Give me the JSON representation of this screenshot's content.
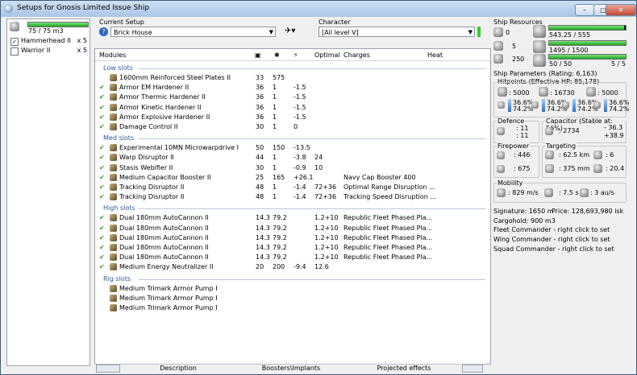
{
  "window": {
    "title": "Setups for Gnosis Limited Issue Ship"
  },
  "cargo": {
    "value": "75 / 75 m3",
    "fill": 1.0
  },
  "drones": [
    {
      "label": "Hammerhead II",
      "count": "x 5",
      "checked": true
    },
    {
      "label": "Warrior II",
      "count": "x 5",
      "checked": false
    }
  ],
  "setup": {
    "heading": "Current Setup",
    "value": "Brick House"
  },
  "character": {
    "heading": "Character",
    "value": "[All level V]"
  },
  "columns": {
    "modules": "Modules",
    "optimal": "Optimal",
    "charges": "Charges",
    "heat": "Heat"
  },
  "slots": [
    {
      "title": "Low slots",
      "items": [
        {
          "name": "1600mm Reinforced Steel Plates II",
          "a": "33",
          "b": "575",
          "c": "",
          "optimal": "",
          "charges": "",
          "check": false
        },
        {
          "name": "Armor EM Hardener II",
          "a": "36",
          "b": "1",
          "c": "-1.5",
          "optimal": "",
          "charges": "",
          "check": true
        },
        {
          "name": "Armor Thermic Hardener II",
          "a": "36",
          "b": "1",
          "c": "-1.5",
          "optimal": "",
          "charges": "",
          "check": true
        },
        {
          "name": "Armor Kinetic Hardener II",
          "a": "36",
          "b": "1",
          "c": "-1.5",
          "optimal": "",
          "charges": "",
          "check": true
        },
        {
          "name": "Armor Explosive Hardener II",
          "a": "36",
          "b": "1",
          "c": "-1.5",
          "optimal": "",
          "charges": "",
          "check": true
        },
        {
          "name": "Damage Control II",
          "a": "30",
          "b": "1",
          "c": "0",
          "optimal": "",
          "charges": "",
          "check": true
        }
      ]
    },
    {
      "title": "Med slots",
      "items": [
        {
          "name": "Experimental 10MN Microwarpdrive I",
          "a": "50",
          "b": "150",
          "c": "-13.5",
          "optimal": "",
          "charges": "",
          "check": true
        },
        {
          "name": "Warp Disruptor II",
          "a": "44",
          "b": "1",
          "c": "-3.8",
          "optimal": "24",
          "charges": "",
          "check": true
        },
        {
          "name": "Stasis Webifier II",
          "a": "30",
          "b": "1",
          "c": "-0.9",
          "optimal": "10",
          "charges": "",
          "check": true
        },
        {
          "name": "Medium Capacitor Booster II",
          "a": "25",
          "b": "165",
          "c": "+26.1",
          "optimal": "",
          "charges": "Navy Cap Booster 400",
          "check": true
        },
        {
          "name": "Tracking Disruptor II",
          "a": "48",
          "b": "1",
          "c": "-1.4",
          "optimal": "72+36",
          "charges": "Optimal Range Disruption ...",
          "check": true
        },
        {
          "name": "Tracking Disruptor II",
          "a": "48",
          "b": "1",
          "c": "-1.4",
          "optimal": "72+36",
          "charges": "Tracking Speed Disruption ...",
          "check": true
        }
      ]
    },
    {
      "title": "High slots",
      "items": [
        {
          "name": "Dual 180mm AutoCannon II",
          "a": "14.3",
          "b": "79.2",
          "c": "",
          "optimal": "1.2+10",
          "charges": "Republic Fleet Phased Pla...",
          "check": true
        },
        {
          "name": "Dual 180mm AutoCannon II",
          "a": "14.3",
          "b": "79.2",
          "c": "",
          "optimal": "1.2+10",
          "charges": "Republic Fleet Phased Pla...",
          "check": true
        },
        {
          "name": "Dual 180mm AutoCannon II",
          "a": "14.3",
          "b": "79.2",
          "c": "",
          "optimal": "1.2+10",
          "charges": "Republic Fleet Phased Pla...",
          "check": true
        },
        {
          "name": "Dual 180mm AutoCannon II",
          "a": "14.3",
          "b": "79.2",
          "c": "",
          "optimal": "1.2+10",
          "charges": "Republic Fleet Phased Pla...",
          "check": true
        },
        {
          "name": "Dual 180mm AutoCannon II",
          "a": "14.3",
          "b": "79.2",
          "c": "",
          "optimal": "1.2+10",
          "charges": "Republic Fleet Phased Pla...",
          "check": true
        },
        {
          "name": "Medium Energy Neutralizer II",
          "a": "20",
          "b": "200",
          "c": "-9.4",
          "optimal": "12.6",
          "charges": "",
          "check": true
        }
      ]
    },
    {
      "title": "Rig slots",
      "items": [
        {
          "name": "Medium Trimark Armor Pump I",
          "a": "",
          "b": "",
          "c": "",
          "optimal": "",
          "charges": "",
          "check": false
        },
        {
          "name": "Medium Trimark Armor Pump I",
          "a": "",
          "b": "",
          "c": "",
          "optimal": "",
          "charges": "",
          "check": false
        },
        {
          "name": "Medium Trimark Armor Pump I",
          "a": "",
          "b": "",
          "c": "",
          "optimal": "",
          "charges": "",
          "check": false
        }
      ]
    }
  ],
  "resources": {
    "title": "Ship Resources",
    "hardpoints": {
      "turret": "0",
      "launcher": "5",
      "calibration": "250"
    },
    "cpu": {
      "value": "543.25 / 555",
      "fill": 0.979
    },
    "power": {
      "value": "1495 / 1500",
      "fill": 0.997
    },
    "drone_bay": {
      "value": "50 / 50",
      "extra": "5 / 5",
      "fill": 1.0
    }
  },
  "params": {
    "title": "Ship Parameters (Rating: 6,163)",
    "hitpoints_title": "Hitpoints (Effective HP: 85,178)",
    "hp": {
      "shield": "5000",
      "armor": "16730",
      "hull": "5000"
    },
    "resists": [
      {
        "top": "36.6%",
        "bottom": "74.2%"
      },
      {
        "top": "36.6%",
        "bottom": "74.2%"
      },
      {
        "top": "36.6%",
        "bottom": "74.2%"
      },
      {
        "top": "36.6%",
        "bottom": "74.2%"
      }
    ],
    "defence": {
      "title": "Defence",
      "v1": ": 11",
      "v2": ": 11"
    },
    "capacitor": {
      "title": "Capacitor (Stable at: 56%)",
      "value": ": 2734",
      "delta_top": "- 36.3",
      "delta_bottom": "+38.9"
    },
    "firepower": {
      "title": "Firepower",
      "v1": ": 446",
      "v2": ": 675"
    },
    "targeting": {
      "title": "Targeting",
      "range": ": 62.5 km",
      "targets": ": 6",
      "resolution": ": 375 mm",
      "sensor": ": 20.4"
    },
    "mobility": {
      "title": "Mobility",
      "speed": ": 829 m/s",
      "align": ": 7.5 s",
      "warp": ": 3 au/s"
    },
    "signature": "Signature: 1650 m",
    "price": "Price: 128,693,980 isk",
    "cargohold": "Cargohold: 900 m3",
    "fleet": "Fleet Commander - right click to set",
    "wing": "Wing Commander - right click to set",
    "squad": "Squad Commander - right click to set"
  },
  "tabs": {
    "description": "Description",
    "boosters": "Boosters\\Implants",
    "projected": "Projected effects"
  }
}
